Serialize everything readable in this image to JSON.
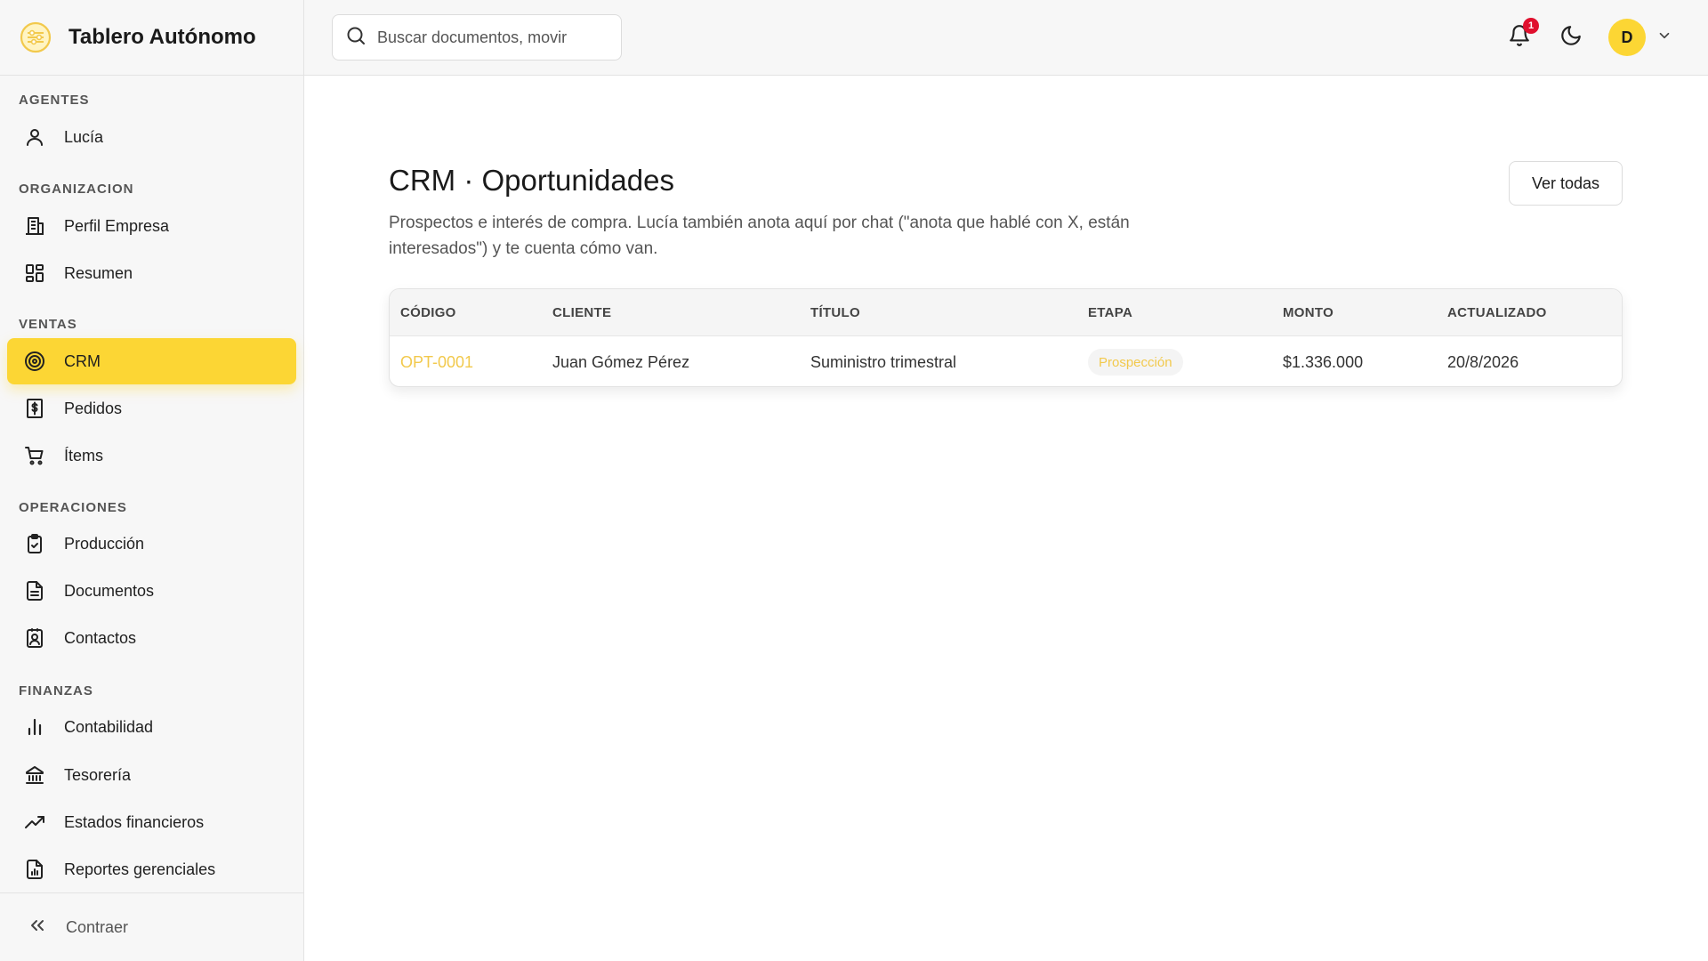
{
  "app": {
    "title": "Tablero Autónomo"
  },
  "sidebar": {
    "sections": [
      {
        "label": "AGENTES"
      },
      {
        "label": "ORGANIZACION"
      },
      {
        "label": "VENTAS"
      },
      {
        "label": "OPERACIONES"
      },
      {
        "label": "FINANZAS"
      }
    ],
    "items": [
      {
        "label": "Lucía",
        "icon": "user-icon"
      },
      {
        "label": "Perfil Empresa",
        "icon": "building-icon"
      },
      {
        "label": "Resumen",
        "icon": "dashboard-grid-icon"
      },
      {
        "label": "CRM",
        "icon": "target-icon",
        "active": true
      },
      {
        "label": "Pedidos",
        "icon": "receipt-dollar-icon"
      },
      {
        "label": "Ítems",
        "icon": "cart-icon"
      },
      {
        "label": "Producción",
        "icon": "clipboard-check-icon"
      },
      {
        "label": "Documentos",
        "icon": "document-icon"
      },
      {
        "label": "Contactos",
        "icon": "contact-card-icon"
      },
      {
        "label": "Contabilidad",
        "icon": "bar-chart-icon"
      },
      {
        "label": "Tesorería",
        "icon": "bank-icon"
      },
      {
        "label": "Estados financieros",
        "icon": "trending-up-icon"
      },
      {
        "label": "Reportes gerenciales",
        "icon": "report-chart-icon"
      }
    ],
    "collapse_label": "Contraer"
  },
  "topbar": {
    "search_placeholder": "Buscar documentos, movir",
    "notification_count": "1",
    "avatar_initial": "D"
  },
  "main": {
    "title": "CRM · Oportunidades",
    "description": "Prospectos e interés de compra. Lucía también anota aquí por chat (\"anota que hablé con X, están interesados\") y te cuenta cómo van.",
    "view_all_label": "Ver todas",
    "table": {
      "columns": [
        "CÓDIGO",
        "CLIENTE",
        "TÍTULO",
        "ETAPA",
        "MONTO",
        "ACTUALIZADO"
      ],
      "rows": [
        {
          "code": "OPT-0001",
          "client": "Juan Gómez Pérez",
          "title": "Suministro trimestral",
          "stage": "Prospección",
          "amount": "$1.336.000",
          "updated": "20/8/2026"
        }
      ]
    }
  },
  "colors": {
    "accent": "#fcd634",
    "accent_text": "#f2c94c",
    "badge": "#e0102e"
  }
}
